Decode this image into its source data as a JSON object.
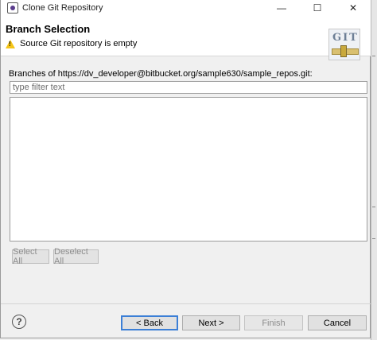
{
  "window": {
    "title": "Clone Git Repository",
    "minimize": "—",
    "maximize": "☐",
    "close": "✕"
  },
  "header": {
    "title": "Branch Selection",
    "message": "Source Git repository is empty",
    "logo_text": "GIT"
  },
  "branches": {
    "label": "Branches of https://dv_developer@bitbucket.org/sample630/sample_repos.git:",
    "filter_value": "",
    "filter_placeholder": "type filter text",
    "items": []
  },
  "actions": {
    "select_all": "Select All",
    "deselect_all": "Deselect All"
  },
  "footer": {
    "help": "?",
    "back": "< Back",
    "next": "Next >",
    "finish": "Finish",
    "cancel": "Cancel"
  },
  "colors": {
    "warning": "#f5c518",
    "focus_border": "#3c7fd6"
  }
}
